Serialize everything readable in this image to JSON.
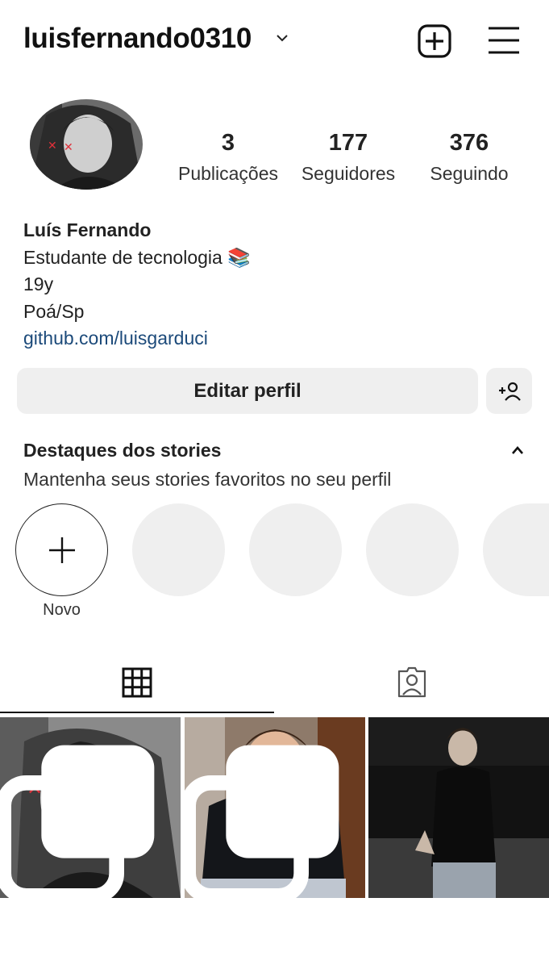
{
  "header": {
    "username": "luisfernando0310",
    "caret_icon": "chevron-down-icon",
    "create_icon": "plus-square-icon",
    "menu_icon": "hamburger-menu-icon"
  },
  "profile": {
    "stats": {
      "posts_count": "3",
      "posts_label": "Publicações",
      "followers_count": "177",
      "followers_label": "Seguidores",
      "following_count": "376",
      "following_label": "Seguindo"
    },
    "bio": {
      "name": "Luís Fernando",
      "line1": "Estudante de tecnologia 📚",
      "line2": "19y",
      "line3": "Poá/Sp",
      "link": "github.com/luisgarduci"
    }
  },
  "actions": {
    "edit_label": "Editar perfil",
    "suggest_icon": "add-person-icon"
  },
  "highlights": {
    "title": "Destaques dos stories",
    "subtitle": "Mantenha seus stories favoritos no seu perfil",
    "new_label": "Novo"
  },
  "tabs": {
    "grid_icon": "grid-icon",
    "tagged_icon": "tagged-user-icon"
  },
  "colors": {
    "link": "#1c4a7a",
    "button_bg": "#efefef",
    "text": "#222222"
  }
}
